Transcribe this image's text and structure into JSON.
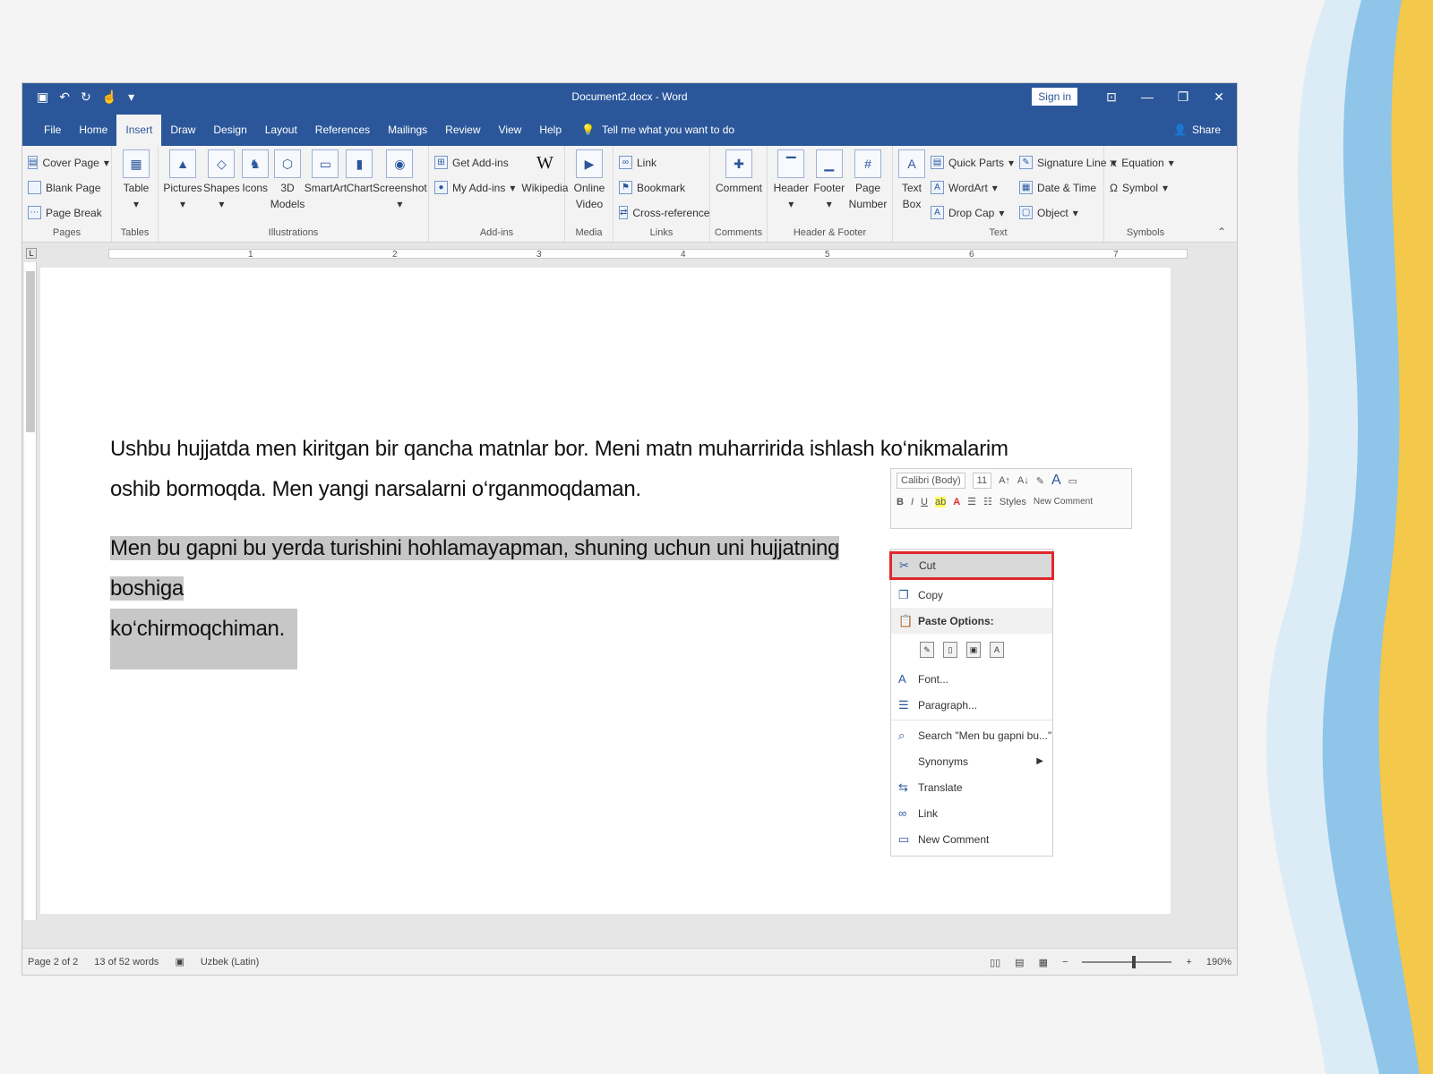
{
  "window": {
    "title": "Document2.docx - Word",
    "sign_in": "Sign in",
    "share": "Share"
  },
  "tabs": [
    "File",
    "Home",
    "Insert",
    "Draw",
    "Design",
    "Layout",
    "References",
    "Mailings",
    "Review",
    "View",
    "Help"
  ],
  "active_tab": "Insert",
  "tell_me": "Tell me what you want to do",
  "ribbon": {
    "pages": {
      "label": "Pages",
      "cover_page": "Cover Page",
      "blank_page": "Blank Page",
      "page_break": "Page Break"
    },
    "tables": {
      "label": "Tables",
      "table": "Table"
    },
    "illustrations": {
      "label": "Illustrations",
      "pictures": "Pictures",
      "shapes": "Shapes",
      "icons": "Icons",
      "models": "3D Models",
      "smartart": "SmartArt",
      "chart": "Chart",
      "screenshot": "Screenshot"
    },
    "addins": {
      "label": "Add-ins",
      "get_addins": "Get Add-ins",
      "my_addins": "My Add-ins",
      "wikipedia": "Wikipedia"
    },
    "media": {
      "label": "Media",
      "online_video": "Online Video"
    },
    "links": {
      "label": "Links",
      "link": "Link",
      "bookmark": "Bookmark",
      "cross_reference": "Cross-reference"
    },
    "comments": {
      "label": "Comments",
      "comment": "Comment"
    },
    "header_footer": {
      "label": "Header & Footer",
      "header": "Header",
      "footer": "Footer",
      "page_number": "Page Number"
    },
    "text": {
      "label": "Text",
      "text_box": "Text Box",
      "quick_parts": "Quick Parts",
      "wordart": "WordArt",
      "drop_cap": "Drop Cap",
      "signature_line": "Signature Line",
      "date_time": "Date & Time",
      "object": "Object"
    },
    "symbols": {
      "label": "Symbols",
      "equation": "Equation",
      "symbol": "Symbol"
    }
  },
  "ruler_marks": [
    "1",
    "2",
    "3",
    "4",
    "5",
    "6",
    "7"
  ],
  "document": {
    "paragraph1": "Ushbu hujjatda men kiritgan bir qancha matnlar bor. Meni matn muharririda ishlash ko‘nikmalarim oshib bormoqda. Men yangi narsalarni o‘rganmoqdaman.",
    "paragraph2_line1": "Men bu gapni bu yerda turishini hohlamayapman, shuning uchun uni hujjatning boshiga",
    "paragraph2_line2": "ko‘chirmoqchiman."
  },
  "mini_toolbar": {
    "font": "Calibri (Body)",
    "size": "11",
    "styles": "Styles",
    "new_comment": "New Comment"
  },
  "context_menu": {
    "cut": "Cut",
    "copy": "Copy",
    "paste_options": "Paste Options:",
    "font": "Font...",
    "paragraph": "Paragraph...",
    "search": "Search \"Men bu gapni bu...\"",
    "synonyms": "Synonyms",
    "translate": "Translate",
    "link": "Link",
    "new_comment": "New Comment"
  },
  "status": {
    "page": "Page 2 of 2",
    "words": "13 of 52 words",
    "language": "Uzbek (Latin)",
    "zoom": "190%"
  },
  "colors": {
    "brand_blue": "#2b579a",
    "highlight_red": "#e0282e",
    "selection_grey": "#c7c7c7"
  }
}
